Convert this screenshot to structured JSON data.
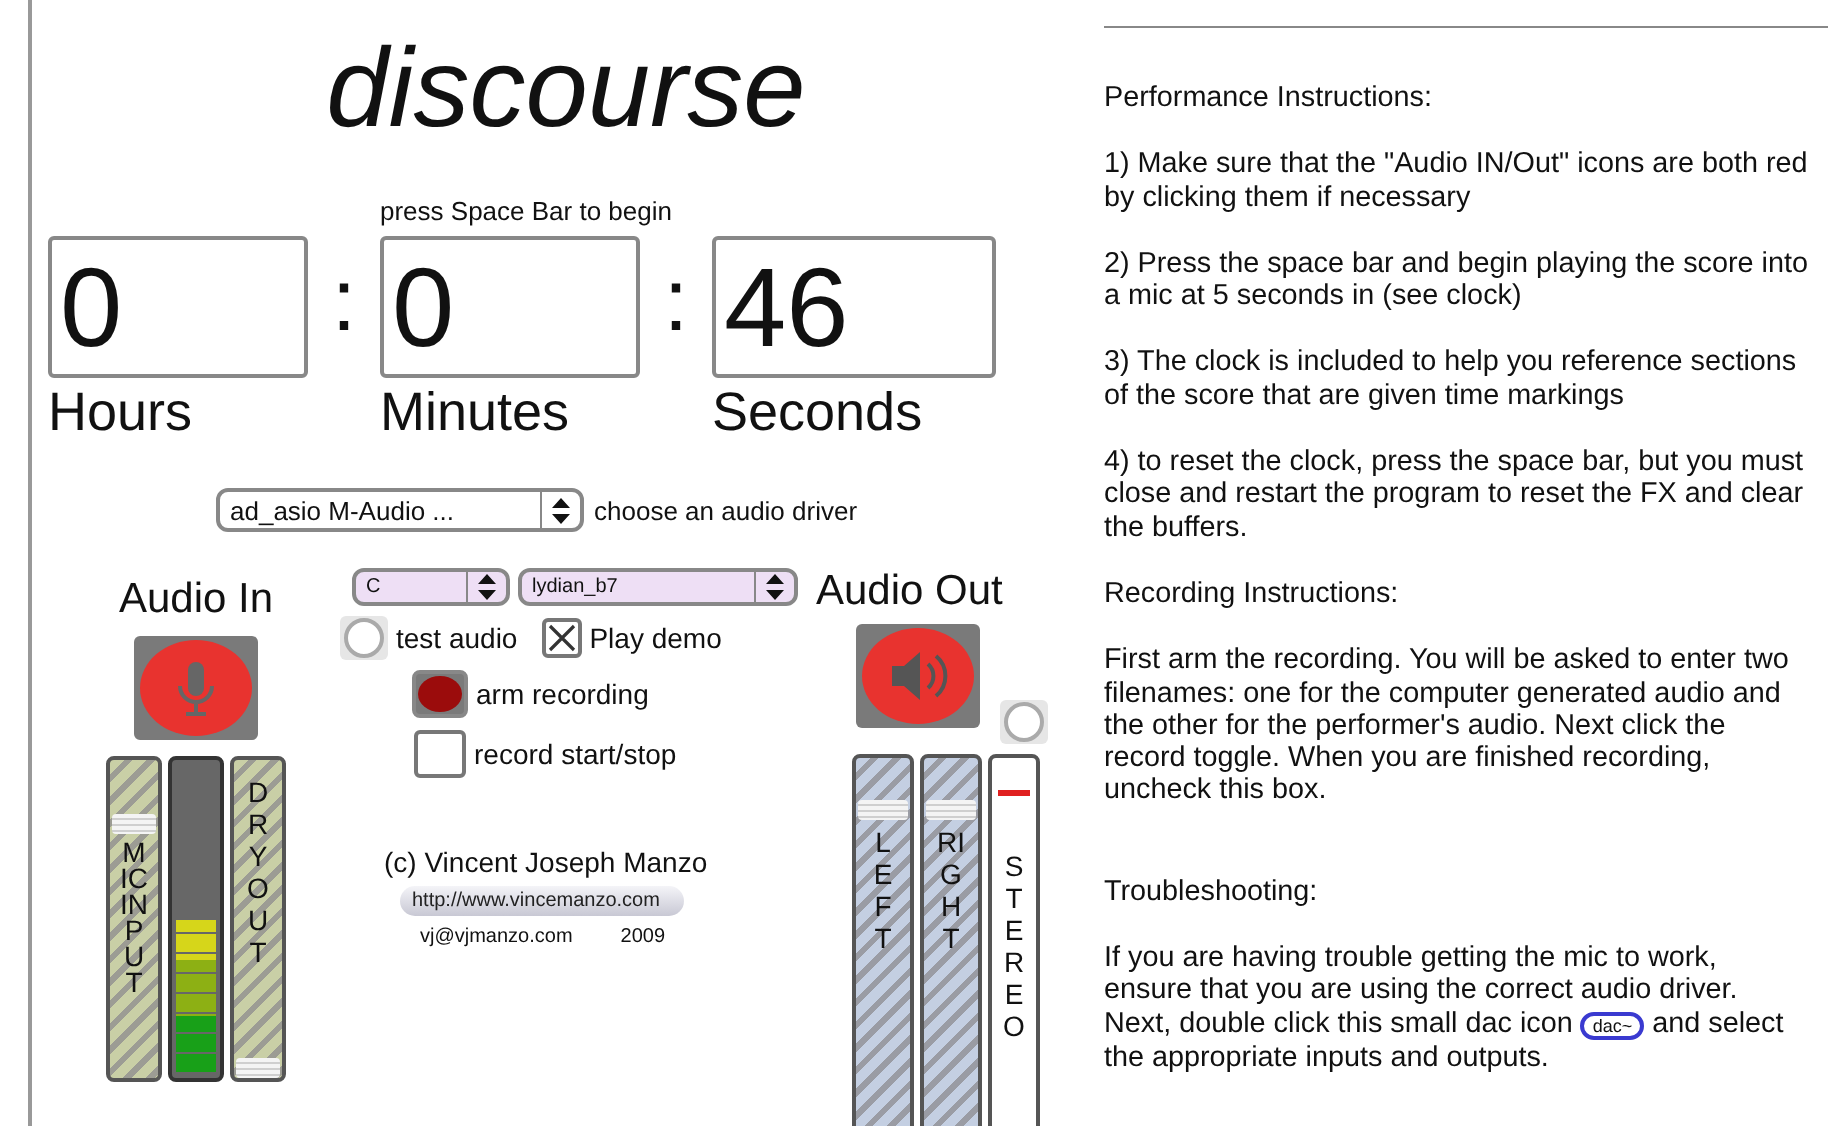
{
  "title": "discourse",
  "prompt": "press Space Bar to begin",
  "clock": {
    "units": [
      {
        "value": "0",
        "label": "Hours"
      },
      {
        "value": "0",
        "label": "Minutes"
      },
      {
        "value": "46",
        "label": "Seconds"
      }
    ],
    "separators": [
      ":",
      ":"
    ]
  },
  "driver": {
    "value": "ad_asio M-Audio ...",
    "label": "choose an audio driver"
  },
  "audio_in": {
    "label": "Audio In",
    "on": true,
    "strips": [
      {
        "kind": "slider",
        "label": "MIC INPUT",
        "level": 0.8
      },
      {
        "kind": "meter",
        "level": 0.5
      },
      {
        "kind": "slider",
        "label": "DRY OUT",
        "level": 0.03
      }
    ]
  },
  "key": {
    "value": "C"
  },
  "scale": {
    "value": "lydian_b7"
  },
  "test_audio": {
    "label": "test audio",
    "on": false
  },
  "play_demo": {
    "label": "Play demo",
    "checked": true
  },
  "arm_recording": {
    "label": "arm recording",
    "on": true
  },
  "record": {
    "label": "record start/stop",
    "checked": false
  },
  "credits": {
    "author": "(c) Vincent Joseph Manzo",
    "url": "http://www.vincemanzo.com",
    "email": "vj@vjmanzo.com",
    "year": "2009"
  },
  "audio_out": {
    "label": "Audio Out",
    "on": true,
    "stereo_on": false,
    "strips": [
      {
        "kind": "slider",
        "label": "LEFT",
        "level": 0.86
      },
      {
        "kind": "slider",
        "label": "RIGHT",
        "level": 0.86
      },
      {
        "kind": "stereo",
        "label": "STEREO",
        "level": 0.9
      }
    ]
  },
  "instructions": [
    {
      "heading": "Performance Instructions:",
      "paragraphs": [
        [
          {
            "kind": "text",
            "text": "1) Make sure that the \"Audio IN/Out\" icons are both red by clicking them if necessary"
          }
        ],
        [
          {
            "kind": "text",
            "text": "2) Press the space bar and begin playing the score into a mic at 5 seconds in (see clock)"
          }
        ],
        [
          {
            "kind": "text",
            "text": "3) The clock is included to help you reference sections of the score that are given time markings"
          }
        ],
        [
          {
            "kind": "text",
            "text": "4) to reset the clock, press the space bar, but you must close and restart the program to reset the FX and clear the buffers."
          }
        ]
      ]
    },
    {
      "heading": "Recording Instructions:",
      "paragraphs": [
        [
          {
            "kind": "text",
            "text": "First arm the recording. You will be asked to enter two filenames: one for the computer generated audio and the other for the performer's audio. Next click the record toggle. When you are finished recording, uncheck this box."
          }
        ]
      ]
    },
    {
      "heading": "Troubleshooting:",
      "paragraphs": [
        [
          {
            "kind": "text",
            "text": "If you are having trouble getting the mic to work, ensure that you are using the correct audio driver. Next, double click this small dac icon "
          },
          {
            "kind": "badge",
            "text": "dac~"
          },
          {
            "kind": "text",
            "text": " and select the appropriate inputs and outputs."
          }
        ]
      ]
    }
  ]
}
